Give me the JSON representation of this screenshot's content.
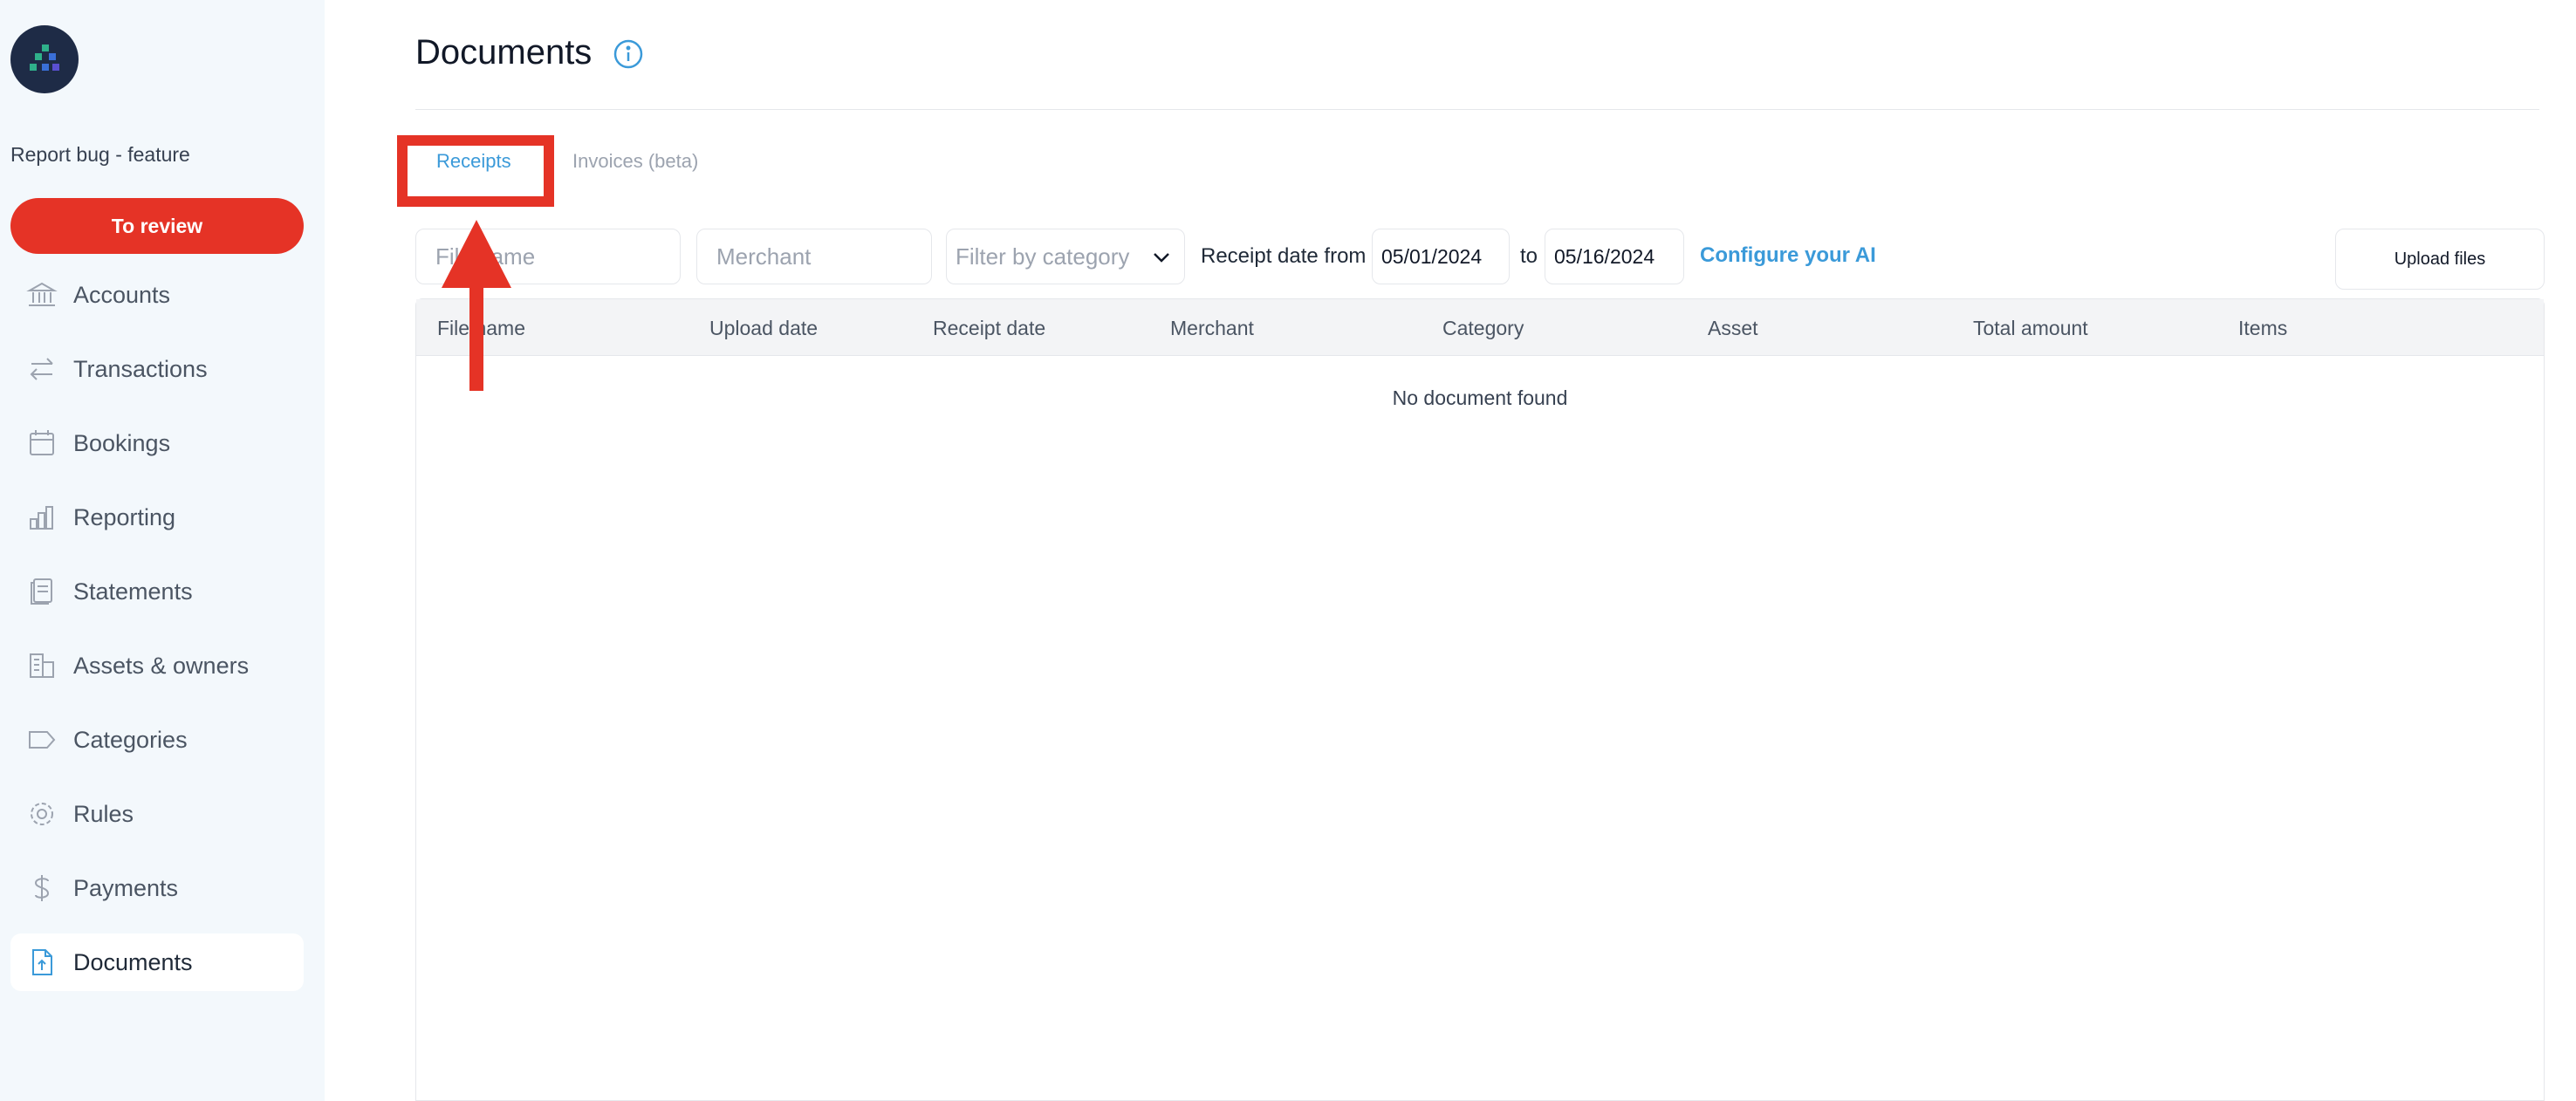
{
  "sidebar": {
    "report_link": "Report bug - feature",
    "review_button": "To review",
    "items": [
      {
        "label": "Accounts",
        "icon": "bank-icon"
      },
      {
        "label": "Transactions",
        "icon": "arrows-icon"
      },
      {
        "label": "Bookings",
        "icon": "calendar-icon"
      },
      {
        "label": "Reporting",
        "icon": "bar-chart-icon"
      },
      {
        "label": "Statements",
        "icon": "statements-icon"
      },
      {
        "label": "Assets & owners",
        "icon": "building-icon"
      },
      {
        "label": "Categories",
        "icon": "tag-icon"
      },
      {
        "label": "Rules",
        "icon": "gear-icon"
      },
      {
        "label": "Payments",
        "icon": "dollar-icon"
      },
      {
        "label": "Documents",
        "icon": "document-upload-icon",
        "active": true
      }
    ]
  },
  "header": {
    "title": "Documents"
  },
  "tabs": [
    {
      "label": "Receipts",
      "active": true
    },
    {
      "label": "Invoices (beta)",
      "active": false
    }
  ],
  "filters": {
    "filename_placeholder": "File name",
    "merchant_placeholder": "Merchant",
    "category_placeholder": "Filter by category",
    "date_label": "Receipt date from",
    "date_from": "05/01/2024",
    "date_to_label": "to",
    "date_to": "05/16/2024",
    "configure_link": "Configure your AI",
    "upload_button": "Upload files"
  },
  "table": {
    "columns": [
      "File name",
      "Upload date",
      "Receipt date",
      "Merchant",
      "Category",
      "Asset",
      "Total amount",
      "Items"
    ],
    "empty_message": "No document found"
  },
  "colors": {
    "accent": "#3b9ad9",
    "review_red": "#e53326",
    "sidebar_bg": "#f3f8fc"
  }
}
